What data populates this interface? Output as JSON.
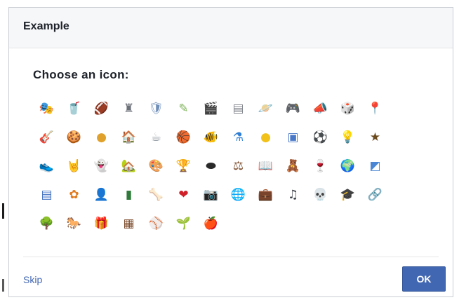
{
  "dialog": {
    "title": "Example",
    "prompt": "Choose an icon:",
    "skip_label": "Skip",
    "ok_label": "OK"
  },
  "icons": [
    {
      "name": "theater-masks-icon",
      "glyph": "🎭",
      "color": "#8a8f99"
    },
    {
      "name": "red-cup-icon",
      "glyph": "🥤",
      "color": "#d0212a"
    },
    {
      "name": "football-icon",
      "glyph": "🏈",
      "color": "#7a3b1c"
    },
    {
      "name": "chess-rook-icon",
      "glyph": "♜",
      "color": "#6c7079"
    },
    {
      "name": "shield-icon",
      "glyph": "🛡",
      "color": "#6f8fb8"
    },
    {
      "name": "paint-swatch-icon",
      "glyph": "✎",
      "color": "#7fb35a"
    },
    {
      "name": "film-clapper-icon",
      "glyph": "🎬",
      "color": "#6b4fa0"
    },
    {
      "name": "document-icon",
      "glyph": "▤",
      "color": "#7d8189"
    },
    {
      "name": "planet-icon",
      "glyph": "🪐",
      "color": "#c88a3c"
    },
    {
      "name": "game-controller-icon",
      "glyph": "🎮",
      "color": "#8a8f99"
    },
    {
      "name": "megaphone-icon",
      "glyph": "📣",
      "color": "#4a86d4"
    },
    {
      "name": "dice-icon",
      "glyph": "🎲",
      "color": "#7a8ea8"
    },
    {
      "name": "pushpin-icon",
      "glyph": "📍",
      "color": "#5b8fc9"
    },
    {
      "name": "guitar-icon",
      "glyph": "🎸",
      "color": "#8a4a1c"
    },
    {
      "name": "cookie-icon",
      "glyph": "🍪",
      "color": "#b6813d"
    },
    {
      "name": "gold-coin-icon",
      "glyph": "●",
      "color": "#e0a22c"
    },
    {
      "name": "house-icon",
      "glyph": "🏠",
      "color": "#4f8a3a"
    },
    {
      "name": "coffee-mug-icon",
      "glyph": "☕",
      "color": "#9aa0a8"
    },
    {
      "name": "basketball-icon",
      "glyph": "🏀",
      "color": "#d45c1e"
    },
    {
      "name": "fishbowl-icon",
      "glyph": "🐠",
      "color": "#e06a2a"
    },
    {
      "name": "flask-icon",
      "glyph": "⚗",
      "color": "#2f7fd4"
    },
    {
      "name": "yellow-ball-icon",
      "glyph": "●",
      "color": "#f2c21b"
    },
    {
      "name": "notepad-icon",
      "glyph": "▣",
      "color": "#4a78c8"
    },
    {
      "name": "soccer-ball-icon",
      "glyph": "⚽",
      "color": "#333333"
    },
    {
      "name": "light-bulb-icon",
      "glyph": "💡",
      "color": "#e8c53a"
    },
    {
      "name": "star-frame-icon",
      "glyph": "★",
      "color": "#6b4a1e"
    },
    {
      "name": "sneaker-icon",
      "glyph": "👟",
      "color": "#4a6f9a"
    },
    {
      "name": "rock-hand-icon",
      "glyph": "🤘",
      "color": "#c08a5a"
    },
    {
      "name": "ghost-icon",
      "glyph": "👻",
      "color": "#b8bcc4"
    },
    {
      "name": "cabin-icon",
      "glyph": "🏡",
      "color": "#7a9a3a"
    },
    {
      "name": "paint-palette-icon",
      "glyph": "🎨",
      "color": "#c89a4a"
    },
    {
      "name": "trophy-icon",
      "glyph": "🏆",
      "color": "#6a5a3a"
    },
    {
      "name": "hockey-puck-icon",
      "glyph": "⬬",
      "color": "#2a2a2a"
    },
    {
      "name": "gavel-icon",
      "glyph": "⚖",
      "color": "#7a4a2a"
    },
    {
      "name": "open-book-icon",
      "glyph": "📖",
      "color": "#6a6e76"
    },
    {
      "name": "teddy-bear-icon",
      "glyph": "🧸",
      "color": "#a0703a"
    },
    {
      "name": "wine-glass-icon",
      "glyph": "🍷",
      "color": "#8a1c2a"
    },
    {
      "name": "globe-icon",
      "glyph": "🌍",
      "color": "#2f8ad4"
    },
    {
      "name": "window-icon",
      "glyph": "◩",
      "color": "#4a86d4"
    },
    {
      "name": "contact-card-icon",
      "glyph": "▤",
      "color": "#3f6fc0"
    },
    {
      "name": "flower-icon",
      "glyph": "✿",
      "color": "#e07a1e"
    },
    {
      "name": "bust-icon",
      "glyph": "👤",
      "color": "#b08a6a"
    },
    {
      "name": "green-book-icon",
      "glyph": "▮",
      "color": "#2f7a3a"
    },
    {
      "name": "bone-icon",
      "glyph": "🦴",
      "color": "#c8a87a"
    },
    {
      "name": "heart-monitor-icon",
      "glyph": "❤",
      "color": "#d0212a"
    },
    {
      "name": "camera-icon",
      "glyph": "📷",
      "color": "#3a3e46"
    },
    {
      "name": "desk-globe-icon",
      "glyph": "🌐",
      "color": "#6a8ab8"
    },
    {
      "name": "briefcase-icon",
      "glyph": "💼",
      "color": "#7a3a1c"
    },
    {
      "name": "music-note-icon",
      "glyph": "♫",
      "color": "#3a3e46"
    },
    {
      "name": "skull-icon",
      "glyph": "💀",
      "color": "#6a6e76"
    },
    {
      "name": "graduation-cap-icon",
      "glyph": "🎓",
      "color": "#2a2a2a"
    },
    {
      "name": "chain-link-icon",
      "glyph": "🔗",
      "color": "#3f6fc0"
    },
    {
      "name": "tree-icon",
      "glyph": "🌳",
      "color": "#3a7a2a"
    },
    {
      "name": "horse-icon",
      "glyph": "🐎",
      "color": "#7a3a1c"
    },
    {
      "name": "gift-icon",
      "glyph": "🎁",
      "color": "#c83a3a"
    },
    {
      "name": "bookshelf-icon",
      "glyph": "▦",
      "color": "#7a4a2a"
    },
    {
      "name": "baseball-icon",
      "glyph": "⚾",
      "color": "#9aa0a8"
    },
    {
      "name": "potted-plant-icon",
      "glyph": "🌱",
      "color": "#6a8a2a"
    },
    {
      "name": "apple-icon",
      "glyph": "🍎",
      "color": "#c81c2a"
    }
  ]
}
